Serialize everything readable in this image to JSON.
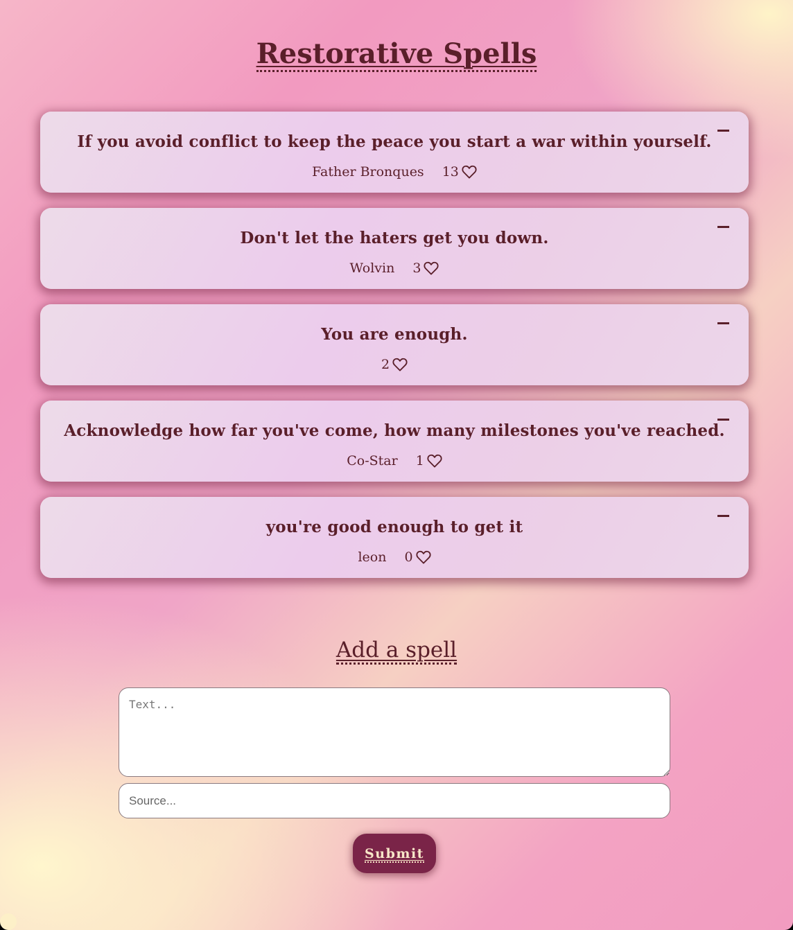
{
  "page": {
    "title": "Restorative Spells"
  },
  "spells": [
    {
      "text": "If you avoid conflict to keep the peace you start a war within yourself.",
      "source": "Father Bronques",
      "likes": "13"
    },
    {
      "text": "Don't let the haters get you down.",
      "source": "Wolvin",
      "likes": "3"
    },
    {
      "text": "You are enough.",
      "source": "",
      "likes": "2"
    },
    {
      "text": "Acknowledge how far you've come, how many milestones you've reached.",
      "source": "Co-Star",
      "likes": "1"
    },
    {
      "text": "you're good enough to get it",
      "source": "leon",
      "likes": "0"
    }
  ],
  "add_form": {
    "title": "Add a spell",
    "text_placeholder": "Text...",
    "source_placeholder": "Source...",
    "submit_label": "Submit"
  },
  "icons": {
    "like": "heart-outline-icon",
    "remove": "minus-icon"
  },
  "colors": {
    "text": "#5a1f2a",
    "card_background": "#ecccec",
    "button_background": "#7a2448",
    "button_text": "#f8e6c8"
  }
}
